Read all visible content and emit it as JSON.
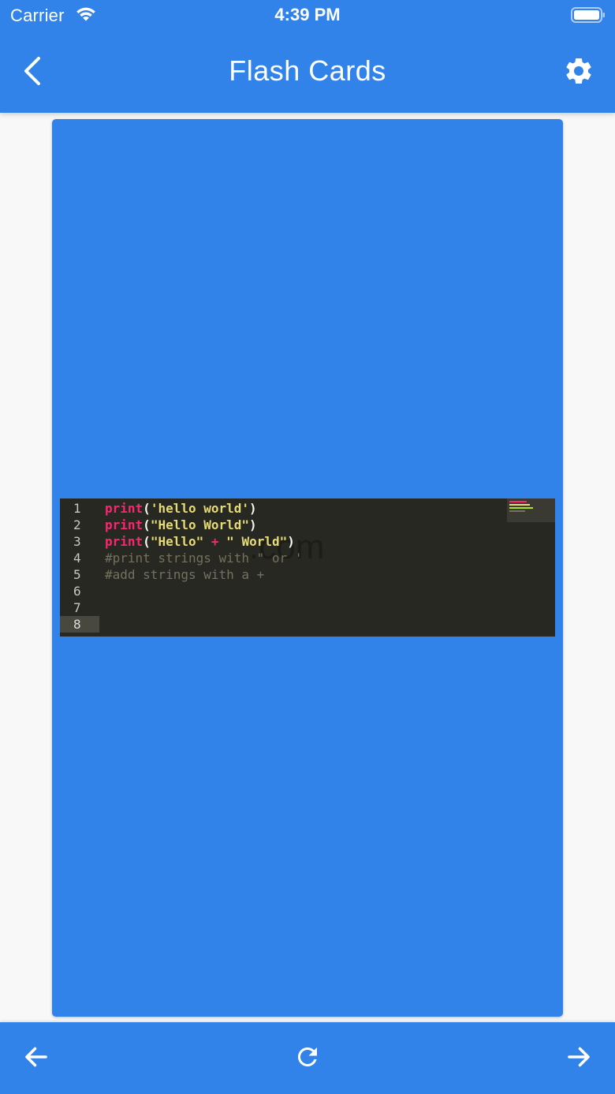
{
  "status_bar": {
    "carrier": "Carrier",
    "time": "4:39 PM"
  },
  "app_bar": {
    "title": "Flash Cards",
    "back_icon": "chevron-left-icon",
    "settings_icon": "gear-icon"
  },
  "card": {
    "color": "#3183ea",
    "code_image": {
      "line_numbers": [
        "1",
        "2",
        "3",
        "4",
        "5",
        "6",
        "7",
        "8"
      ],
      "watermark": ".com"
    }
  },
  "bottom_bar": {
    "prev_icon": "arrow-left-icon",
    "flip_icon": "refresh-icon",
    "next_icon": "arrow-right-icon"
  },
  "colors": {
    "primary": "#3183ea",
    "background": "#f8f8f8",
    "editor_bg": "#272822"
  }
}
